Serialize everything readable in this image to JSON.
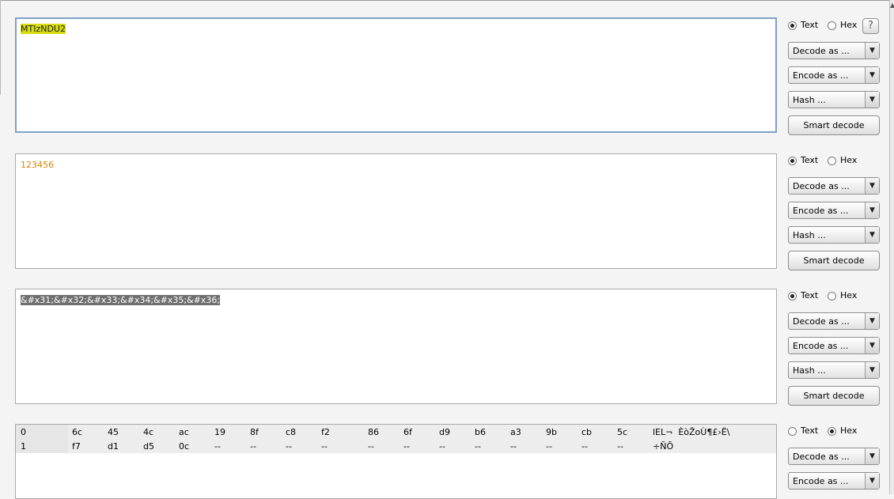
{
  "panels": [
    {
      "text": "MTIzNDU2",
      "mode": "text",
      "radio_text": "Text",
      "radio_hex": "Hex",
      "help": "?",
      "decode": "Decode as ...",
      "encode": "Encode as ...",
      "hash": "Hash ...",
      "smart": "Smart decode"
    },
    {
      "text": "123456",
      "mode": "text",
      "radio_text": "Text",
      "radio_hex": "Hex",
      "decode": "Decode as ...",
      "encode": "Encode as ...",
      "hash": "Hash ...",
      "smart": "Smart decode"
    },
    {
      "text": "&#x31;&#x32;&#x33;&#x34;&#x35;&#x36;",
      "mode": "text",
      "radio_text": "Text",
      "radio_hex": "Hex",
      "decode": "Decode as ...",
      "encode": "Encode as ...",
      "hash": "Hash ...",
      "smart": "Smart decode"
    },
    {
      "mode": "hex",
      "radio_text": "Text",
      "radio_hex": "Hex",
      "decode": "Decode as ...",
      "encode": "Encode as ...",
      "hex_rows": [
        {
          "index": "0",
          "bytes": [
            "6c",
            "45",
            "4c",
            "ac",
            "19",
            "8f",
            "c8",
            "f2",
            "86",
            "6f",
            "d9",
            "b6",
            "a3",
            "9b",
            "cb",
            "5c"
          ],
          "ascii": "lEL¬  ÈòŽoÙ¶£›Ë\\"
        },
        {
          "index": "1",
          "bytes": [
            "f7",
            "d1",
            "d5",
            "0c",
            "--",
            "--",
            "--",
            "--",
            "--",
            "--",
            "--",
            "--",
            "--",
            "--",
            "--",
            "--"
          ],
          "ascii": "÷ÑÕ"
        }
      ]
    }
  ],
  "colors": {
    "highlight_yellow": "#d6dc10",
    "text_orange": "#d4860a",
    "highlight_grey": "#6f6f6f",
    "focus_border": "#7fa0c8"
  },
  "icons": [
    "help-icon",
    "dropdown-arrow-icon"
  ]
}
